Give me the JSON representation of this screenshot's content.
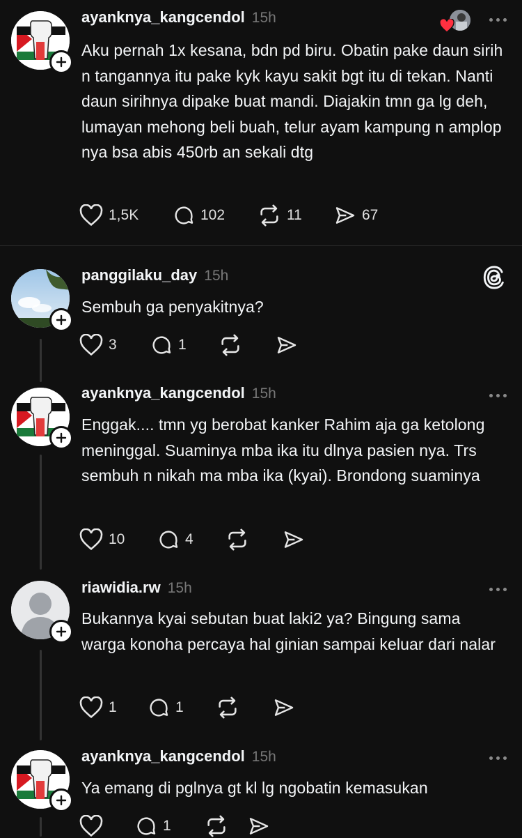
{
  "posts": [
    {
      "username": "ayanknya_kangcendol",
      "time": "15h",
      "text": "Aku pernah 1x kesana, bdn pd biru. Obatin pake daun sirih n tangannya itu pake kyk kayu sakit bgt itu di tekan. Nanti daun sirihnya dipake buat mandi. Diajakin tmn ga lg deh, lumayan mehong beli buah, telur ayam kampung  n amplop nya bsa abis 450rb an sekali dtg",
      "likes": "1,5K",
      "replies": "102",
      "reposts": "11",
      "shares": "67",
      "icons": [
        "heart-icon",
        "comment-icon",
        "repost-icon",
        "send-icon",
        "more-icon"
      ]
    },
    {
      "username": "panggilaku_day",
      "time": "15h",
      "text": "Sembuh ga penyakitnya?",
      "likes": "3",
      "replies": "1",
      "icons": [
        "threads-logo-icon"
      ]
    },
    {
      "username": "ayanknya_kangcendol",
      "time": "15h",
      "text": "Enggak.... tmn yg berobat kanker Rahim aja ga ketolong meninggal.  Suaminya mba ika itu dlnya pasien nya. Trs sembuh n nikah ma mba ika (kyai). Brondong suaminya",
      "likes": "10",
      "replies": "4"
    },
    {
      "username": "riawidia.rw",
      "time": "15h",
      "text": "Bukannya kyai sebutan buat laki2 ya? Bingung sama warga konoha percaya hal ginian sampai keluar dari nalar",
      "likes": "1",
      "replies": "1"
    },
    {
      "username": "ayanknya_kangcendol",
      "time": "15h",
      "text": "Ya emang di pglnya gt kl lg ngobatin kemasukan",
      "replies": "1"
    }
  ],
  "colors": {
    "background": "#101010",
    "text": "#f3f5f7",
    "muted": "#777777",
    "like_red": "#ff3040"
  }
}
